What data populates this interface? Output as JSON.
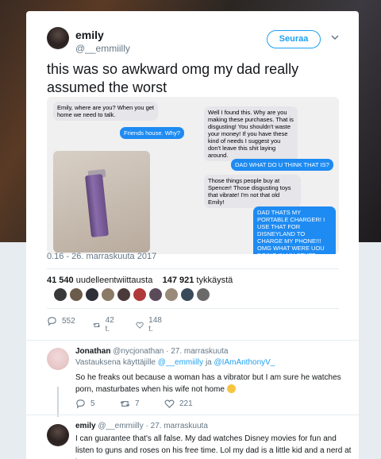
{
  "tweet": {
    "name": "emily",
    "handle": "@__emmiilly",
    "follow_label": "Seuraa",
    "text": "this was so awkward omg my dad really assumed the worst",
    "timestamp": "0.16 - 26. marraskuuta 2017",
    "retweets_count": "41 540",
    "retweets_label": "uudelleentwiittausta",
    "likes_count": "147 921",
    "likes_label": "tykkäystä",
    "reply_count": "552",
    "retweet_count_short": "42 t.",
    "like_count_short": "148 t."
  },
  "chat": {
    "left": [
      {
        "text": "Emily, where are you? When you get home we need to talk."
      },
      {
        "text": "Friends house. Why?"
      }
    ],
    "right": [
      {
        "text": "Well I found this. Why are you making these purchases. That is disgusting! You shouldn't waste your money! If you have these kind of needs I suggest you don't leave this shit laying around."
      },
      {
        "text": "DAD WHAT DO U THINK THAT IS?"
      },
      {
        "text": "Those things people buy at Spencer! Those disgusting toys that vibrate! I'm not that old Emily!"
      },
      {
        "text": "DAD THATS MY PORTABLE CHARGER! I USE THAT FOR DISNEYLAND TO CHARGE MY PHONE!!! OMG WHAT WERE UOU DOING IN MY STUFF BTW??"
      }
    ]
  },
  "replies": [
    {
      "name": "Jonathan",
      "handle": "@nycjonathan",
      "date": "· 27. marraskuuta",
      "reply_prefix": "Vastauksena käyttäjille",
      "reply_user1": "@__emmiilly",
      "reply_and": "ja",
      "reply_user2": "@IAmAnthonyV_",
      "text": "So he freaks out because a woman has a vibrator but I am sure he watches porn, masturbates when his wife not home",
      "reply_count": "5",
      "retweet_count": "7",
      "like_count": "221"
    },
    {
      "name": "emily",
      "handle": "@__emmiilly",
      "date": "· 27. marraskuuta",
      "text": "I can guarantee that's all false. My dad watches Disney movies for fun and listen to guns and roses on his free time. Lol my dad is a little kid and a nerd at heart"
    }
  ],
  "colors": {
    "accent": "#1da1f2",
    "imessage_blue": "#1e8bf2",
    "imessage_gray": "#e5e5ea",
    "muted": "#657786"
  }
}
